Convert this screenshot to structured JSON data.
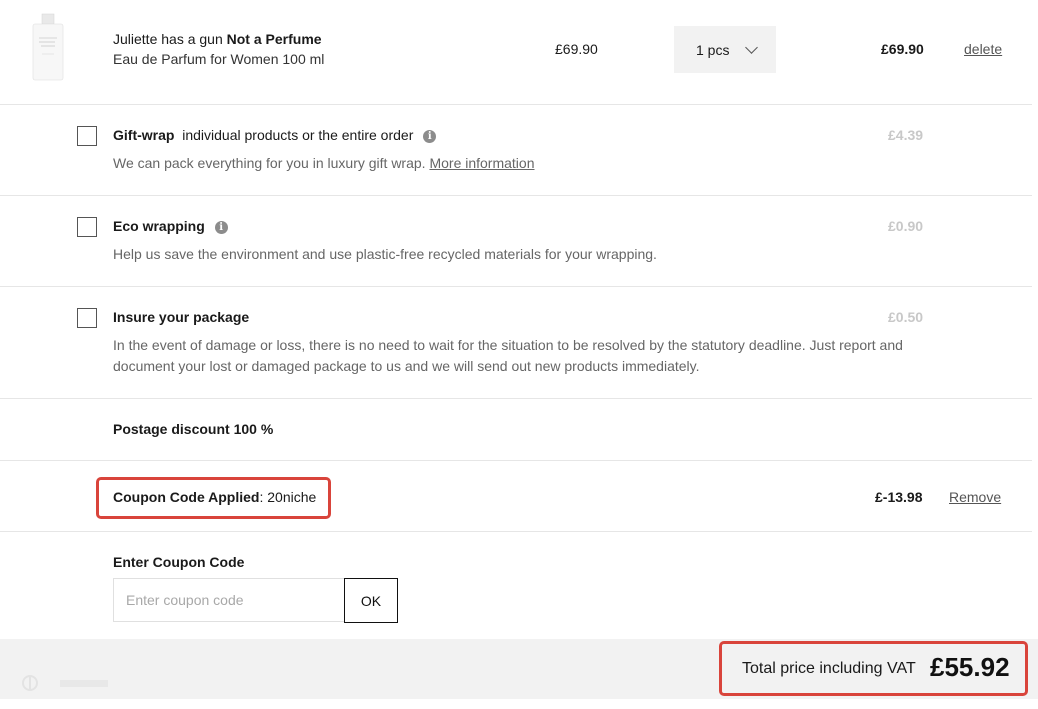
{
  "product": {
    "brand": "Juliette has a gun",
    "name": "Not a Perfume",
    "description": "Eau de Parfum for Women 100 ml",
    "unit_price": "£69.90",
    "quantity": "1 pcs",
    "line_total": "£69.90",
    "delete_label": "delete"
  },
  "options": {
    "gift_wrap": {
      "title": "Gift-wrap",
      "title_suffix": "individual products or the entire order",
      "description": "We can pack everything for you in luxury gift wrap.",
      "more_link": "More information",
      "price": "£4.39",
      "checked": false
    },
    "eco_wrap": {
      "title": "Eco wrapping",
      "description": "Help us save the environment and use plastic-free recycled materials for your wrapping.",
      "price": "£0.90",
      "checked": false
    },
    "insurance": {
      "title": "Insure your package",
      "description": "In the event of damage or loss, there is no need to wait for the situation to be resolved by the statutory deadline. Just report and document your lost or damaged package to us and we will send out new products immediately.",
      "price": "£0.50",
      "checked": false
    }
  },
  "postage": {
    "text": "Postage discount 100 %"
  },
  "coupon_applied": {
    "label": "Coupon Code Applied",
    "code": ": 20niche",
    "discount": "£-13.98",
    "remove_label": "Remove"
  },
  "coupon_entry": {
    "label": "Enter Coupon Code",
    "placeholder": "Enter coupon code",
    "value": "",
    "button_label": "OK"
  },
  "total": {
    "label": "Total price including VAT",
    "value": "£55.92"
  },
  "colors": {
    "highlight_border": "#d9443b",
    "footer_bg": "#f2f2f2",
    "muted_price": "#c8c8c8"
  }
}
